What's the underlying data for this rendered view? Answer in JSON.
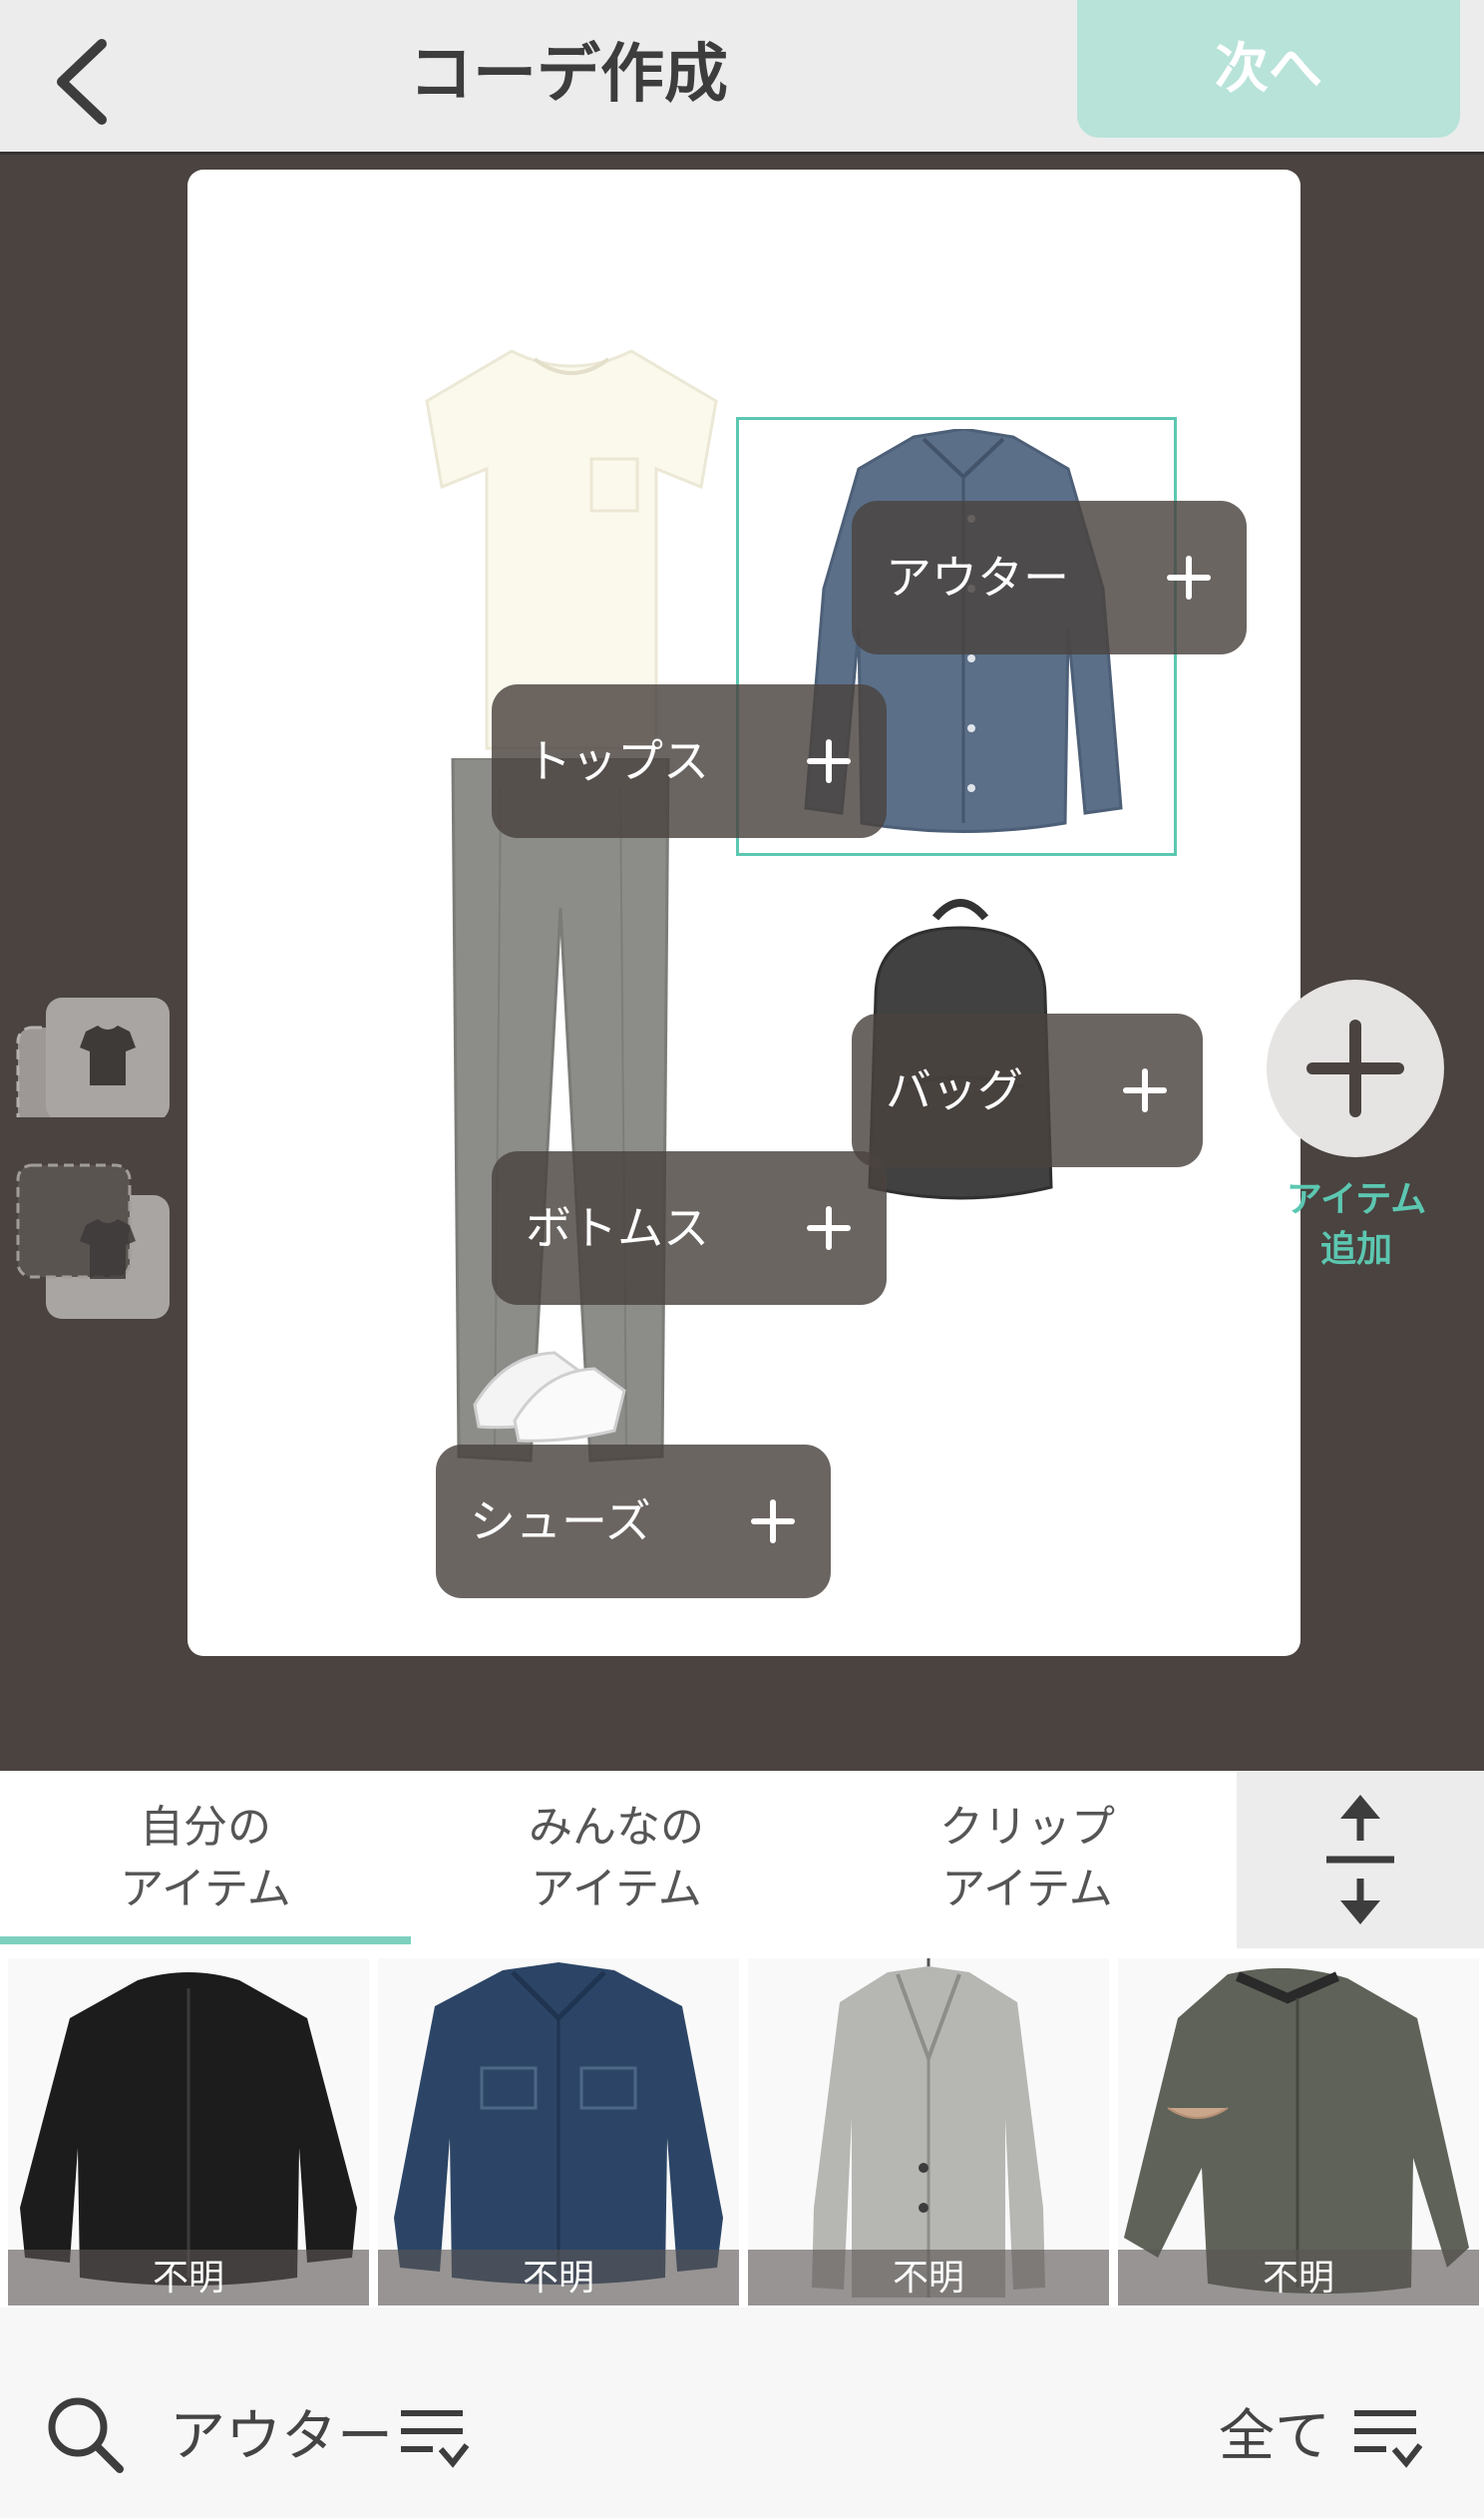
{
  "header": {
    "back_icon": "chevron-left-icon",
    "title": "コーデ作成",
    "next_label": "次へ"
  },
  "canvas": {
    "slots": {
      "outer": "アウター",
      "tops": "トップス",
      "bag": "バッグ",
      "bottoms": "ボトムス",
      "shoes": "シューズ"
    },
    "selection_color": "#5cc7b1"
  },
  "side": {
    "add_item_line1": "アイテム",
    "add_item_line2": "追加"
  },
  "tabs": {
    "items": [
      {
        "line1": "自分の",
        "line2": "アイテム",
        "active": true
      },
      {
        "line1": "みんなの",
        "line2": "アイテム",
        "active": false
      },
      {
        "line1": "クリップ",
        "line2": "アイテム",
        "active": false
      }
    ],
    "expand_icon": "expand-collapse-icon",
    "accent": "#7dd0be"
  },
  "grid": {
    "items": [
      {
        "name": "black-bomber-jacket",
        "brand": "不明"
      },
      {
        "name": "denim-jacket",
        "brand": "不明"
      },
      {
        "name": "grey-chester-coat",
        "brand": "不明"
      },
      {
        "name": "khaki-bomber-jacket",
        "brand": "不明"
      }
    ]
  },
  "bottom_bar": {
    "search_icon": "search-icon",
    "category": "アウター",
    "filter": "全て",
    "sort_icon": "sort-filter-icon"
  }
}
